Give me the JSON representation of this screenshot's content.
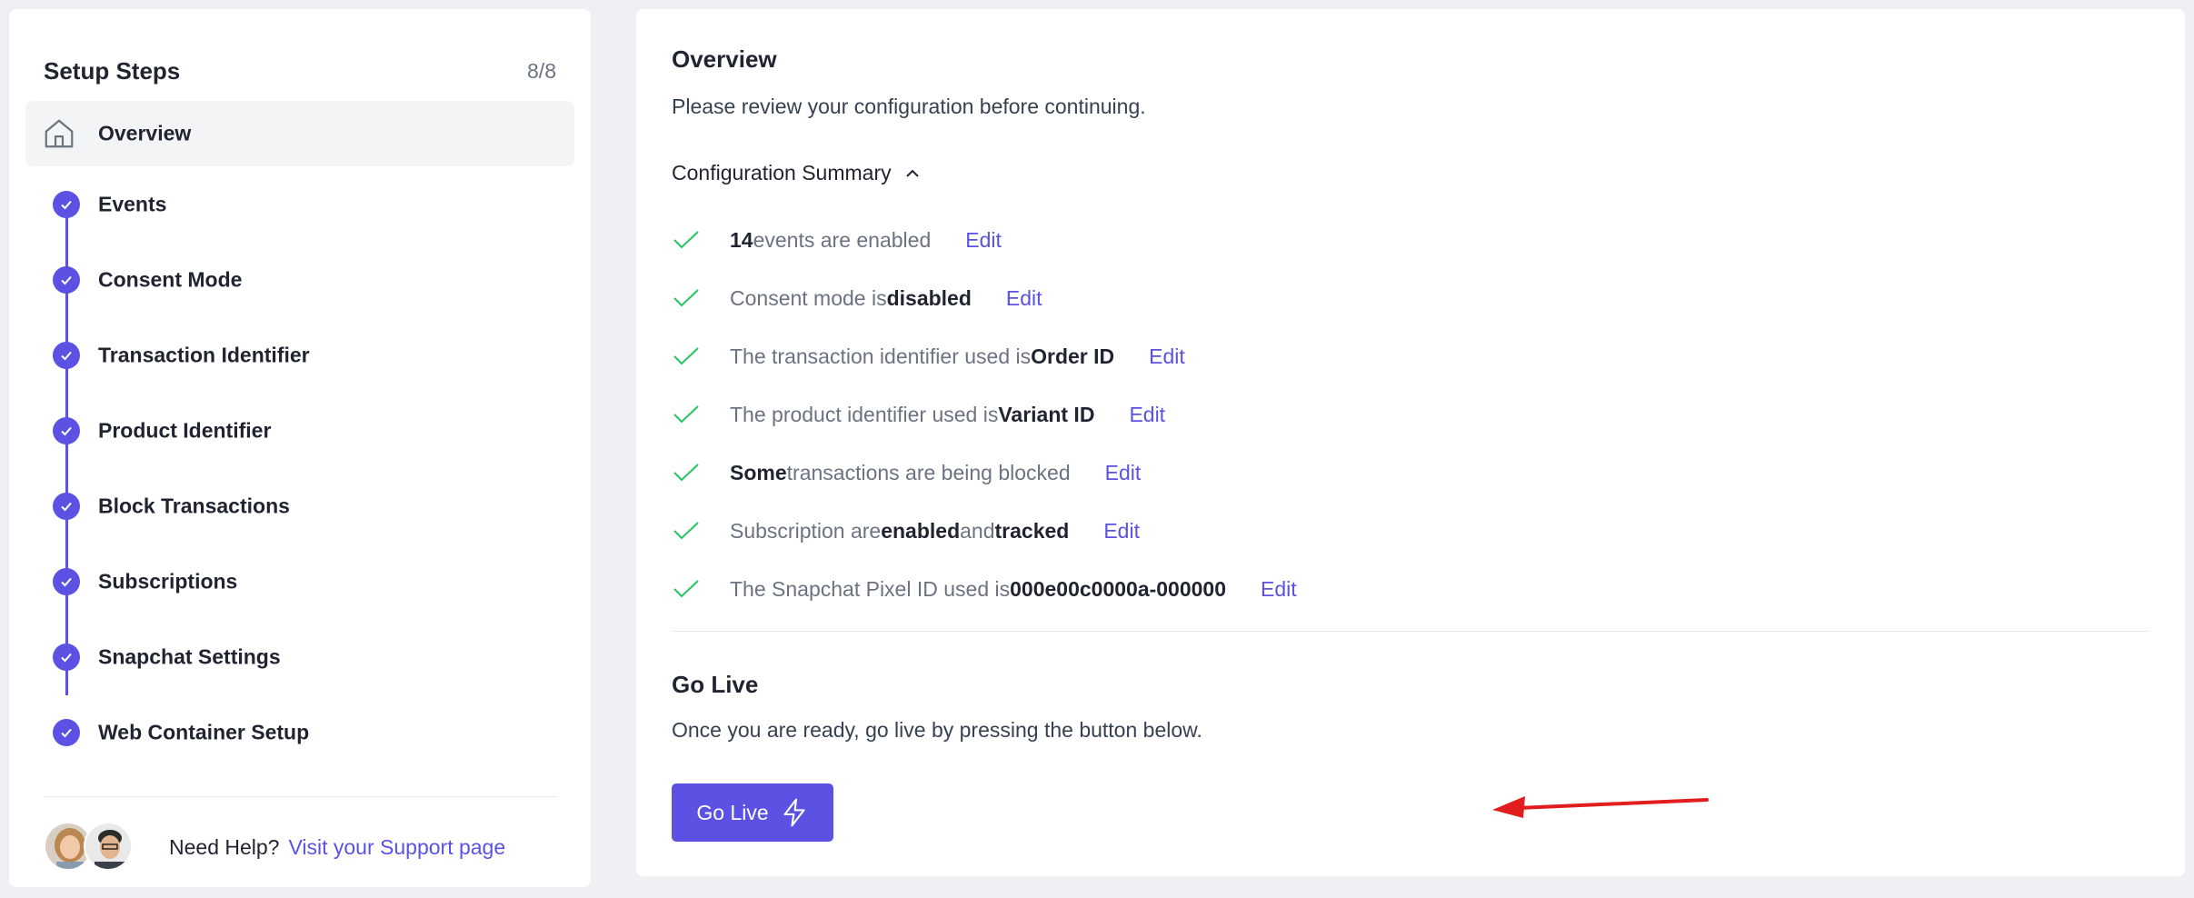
{
  "sidebar": {
    "title": "Setup Steps",
    "count": "8/8",
    "overview_label": "Overview",
    "steps": [
      {
        "label": "Events"
      },
      {
        "label": "Consent Mode"
      },
      {
        "label": "Transaction Identifier"
      },
      {
        "label": "Product Identifier"
      },
      {
        "label": "Block Transactions"
      },
      {
        "label": "Subscriptions"
      },
      {
        "label": "Snapchat Settings"
      },
      {
        "label": "Web Container Setup"
      }
    ],
    "help_text": "Need Help?",
    "help_link": "Visit your Support page"
  },
  "main": {
    "title": "Overview",
    "subtitle": "Please review your configuration before continuing.",
    "summary_toggle": "Configuration Summary",
    "edit_label": "Edit",
    "summary": [
      {
        "parts": [
          "14",
          " events are enabled"
        ]
      },
      {
        "parts": [
          "Consent mode is ",
          "disabled"
        ]
      },
      {
        "parts": [
          "The transaction identifier used is ",
          "Order ID"
        ]
      },
      {
        "parts": [
          "The product identifier used is ",
          "Variant ID"
        ]
      },
      {
        "parts": [
          "Some",
          " transactions are being blocked"
        ]
      },
      {
        "parts": [
          "Subscription are ",
          "enabled",
          " and ",
          "tracked"
        ]
      },
      {
        "parts": [
          "The Snapchat Pixel ID used is ",
          "000e00c0000a-000000"
        ]
      }
    ],
    "go_live_title": "Go Live",
    "go_live_subtitle": "Once you are ready, go live by pressing the button below.",
    "go_live_button": "Go Live"
  },
  "colors": {
    "accent": "#5b52e4",
    "check": "#22c55e",
    "arrow": "#e11d1d"
  },
  "icons": {
    "overview": "home-icon",
    "step_done": "check-circle-icon",
    "summary_item": "check-icon",
    "toggle": "chevron-up-icon",
    "go_live": "lightning-icon"
  }
}
